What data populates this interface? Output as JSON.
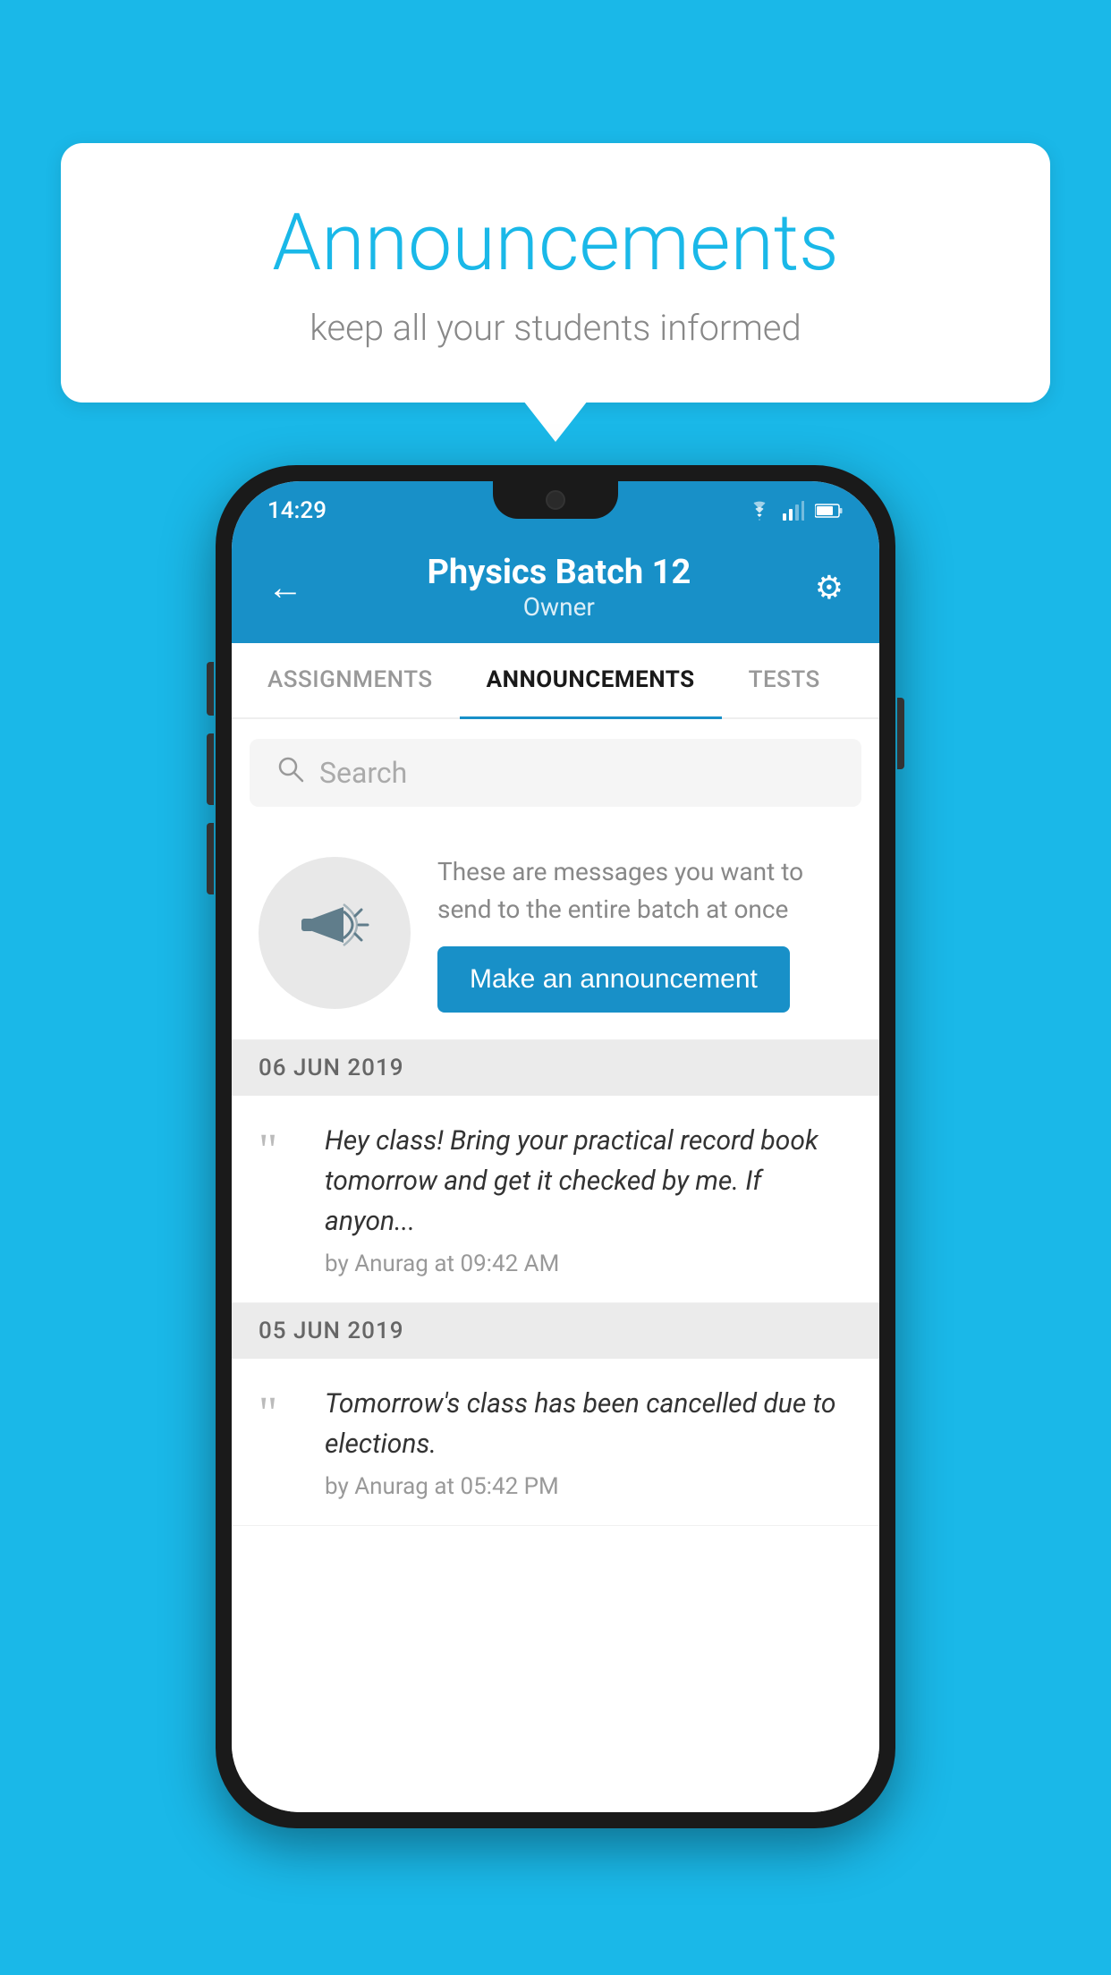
{
  "background_color": "#1ab8e8",
  "speech_bubble": {
    "title": "Announcements",
    "subtitle": "keep all your students informed"
  },
  "phone": {
    "status_bar": {
      "time": "14:29",
      "icons": [
        "wifi",
        "signal",
        "battery"
      ]
    },
    "header": {
      "title": "Physics Batch 12",
      "subtitle": "Owner",
      "back_label": "←",
      "gear_label": "⚙"
    },
    "tabs": [
      {
        "label": "ASSIGNMENTS",
        "active": false
      },
      {
        "label": "ANNOUNCEMENTS",
        "active": true
      },
      {
        "label": "TESTS",
        "active": false
      }
    ],
    "search": {
      "placeholder": "Search"
    },
    "announcement_prompt": {
      "description": "These are messages you want to send to the entire batch at once",
      "button_label": "Make an announcement"
    },
    "announcements": [
      {
        "date": "06  JUN  2019",
        "text": "Hey class! Bring your practical record book tomorrow and get it checked by me. If anyon...",
        "meta": "by Anurag at 09:42 AM"
      },
      {
        "date": "05  JUN  2019",
        "text": "Tomorrow's class has been cancelled due to elections.",
        "meta": "by Anurag at 05:42 PM"
      }
    ]
  }
}
